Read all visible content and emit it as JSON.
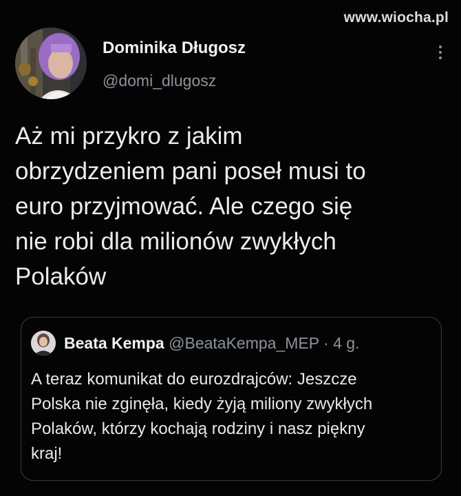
{
  "watermark": "www.wiocha.pl",
  "author": {
    "name": "Dominika Długosz",
    "handle": "@domi_dlugosz"
  },
  "tweet": {
    "lines": [
      "Aż mi przykro z jakim",
      "obrzydzeniem pani poseł musi to",
      "euro przyjmować. Ale czego się",
      "nie robi dla milionów zwykłych",
      "Polaków"
    ]
  },
  "quoted_tweet": {
    "name": "Beata Kempa",
    "handle": "@BeataKempa_MEP",
    "separator": "·",
    "time": "4 g.",
    "lines": [
      "A teraz komunikat do eurozdrajców: Jeszcze",
      "Polska nie zginęła, kiedy żyją miliony zwykłych",
      "Polaków, którzy kochają rodziny i nasz piękny",
      "kraj!"
    ]
  },
  "icons": {
    "menu": "more-vertical-icon"
  },
  "colors": {
    "background": "#040404",
    "text_primary": "#ececec",
    "text_secondary": "#8b939b",
    "border": "#3a3d40",
    "avatar_hair": "#9b6cc4"
  }
}
